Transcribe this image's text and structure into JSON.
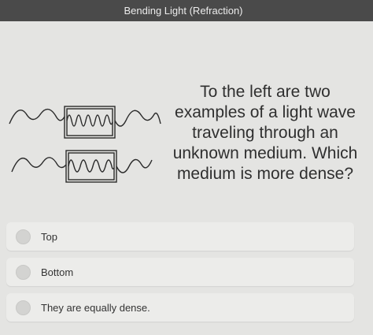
{
  "header": {
    "title": "Bending Light (Refraction)"
  },
  "question": {
    "text": "To the left are two examples of a light wave traveling through an unknown medium. Which medium is more dense?"
  },
  "options": [
    {
      "label": "Top"
    },
    {
      "label": "Bottom"
    },
    {
      "label": "They are equally dense."
    }
  ]
}
